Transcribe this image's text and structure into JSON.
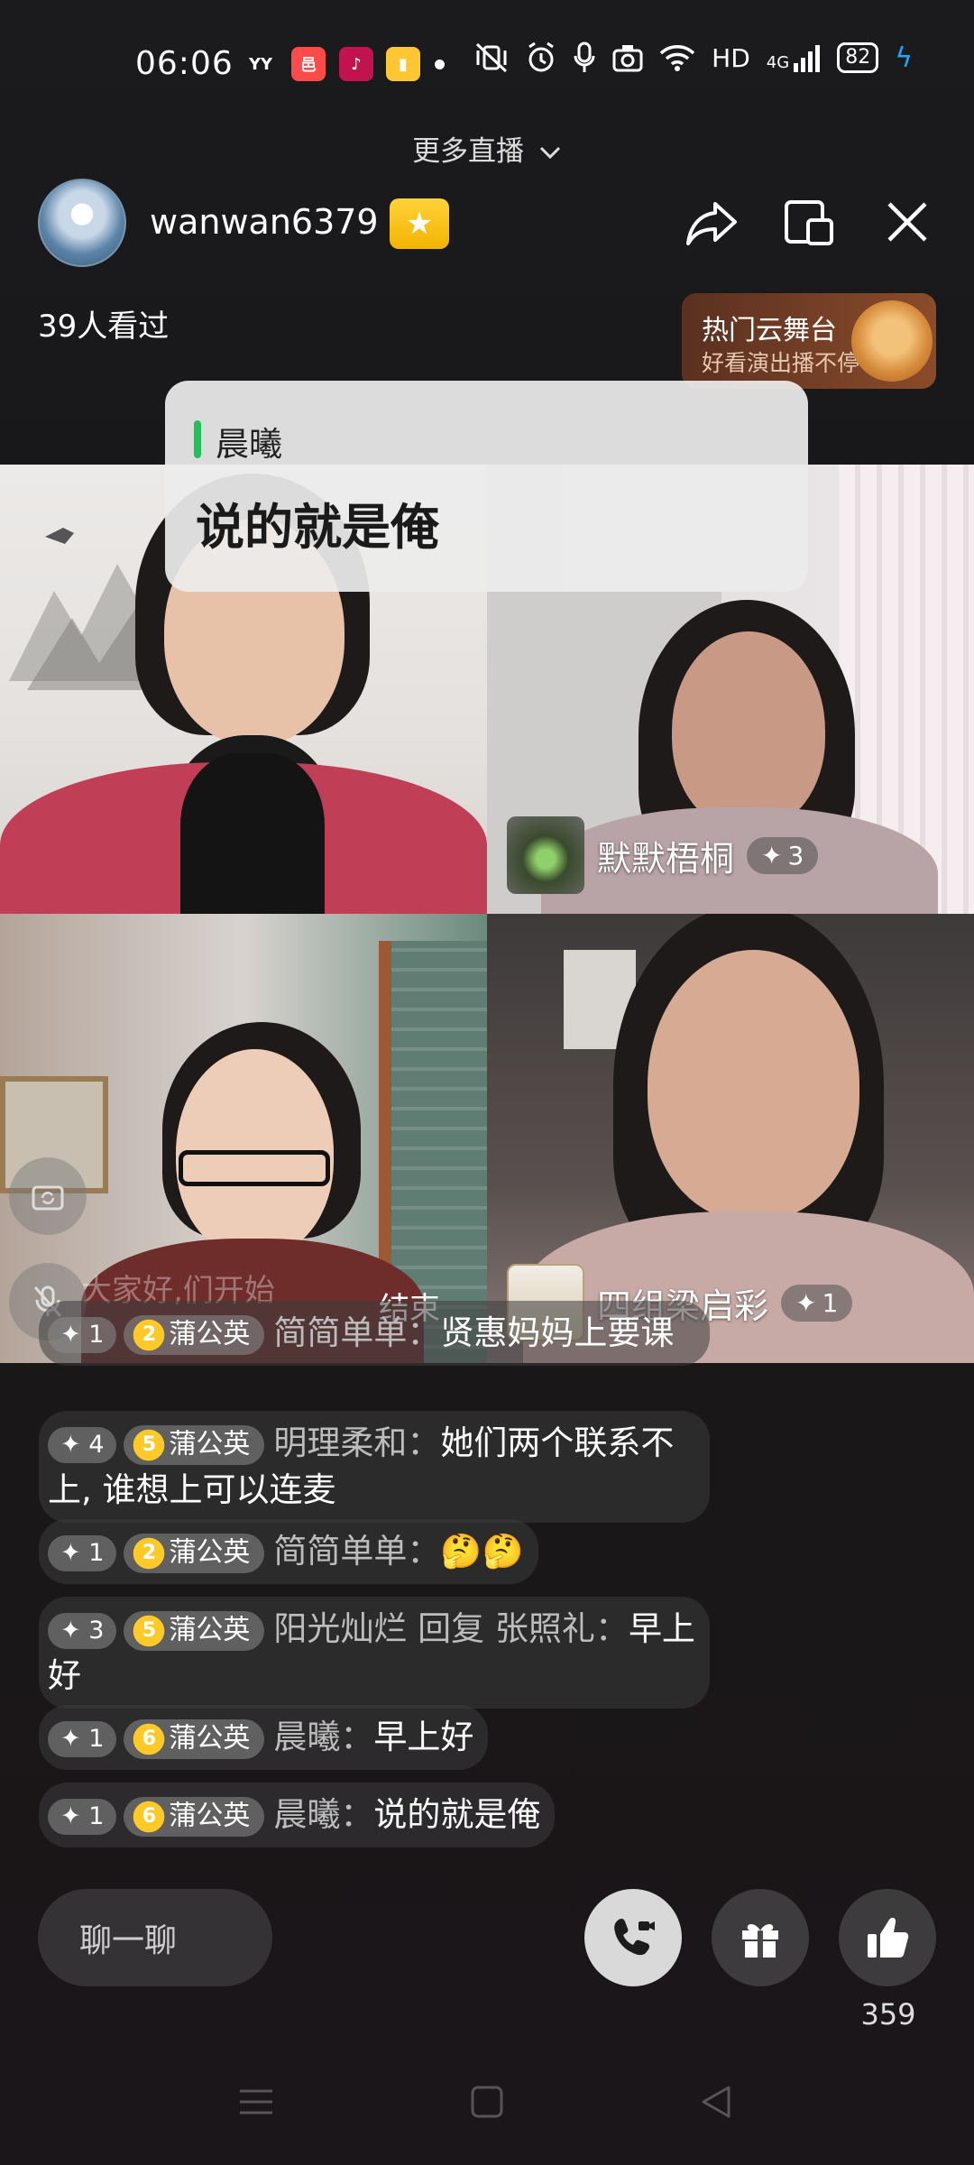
{
  "status_bar": {
    "time": "06:06",
    "app_badges": [
      {
        "name": "yy-app-icon",
        "text": "YY",
        "bg": "#ffd800",
        "fg": "#222"
      },
      {
        "name": "red-app-icon",
        "text": "邑",
        "bg": "#ff4a4a",
        "fg": "#fff"
      },
      {
        "name": "douyin-app-icon",
        "text": "♪",
        "bg": "#e0195b",
        "fg": "#fff"
      },
      {
        "name": "book-app-icon",
        "text": "▮",
        "bg": "#ffc634",
        "fg": "#fff"
      }
    ],
    "network": "HD",
    "signal_label": "4G",
    "battery": "82"
  },
  "header": {
    "more_live": "更多直播",
    "username": "wanwan6379",
    "viewers": "39人看过"
  },
  "promo": {
    "title": "热门云舞台",
    "subtitle": "好看演出播不停"
  },
  "pinned_comment": {
    "name": "晨曦",
    "text": "说的就是俺"
  },
  "tiles": {
    "tile2_user": "默默梧桐",
    "tile2_count": "3",
    "tile4_user": "四组梁启彩",
    "tile4_count": "1",
    "tile3_label_end": "结束",
    "tile3_blur_text": "大家好,们开始"
  },
  "chat": [
    {
      "level": "1",
      "fan_level": "2",
      "fan": "蒲公英",
      "who": "简简单单",
      "msg": "贤惠妈妈上要课"
    },
    {
      "level": "4",
      "fan_level": "5",
      "fan": "蒲公英",
      "who": "明理柔和",
      "msg": "她们两个联系不上, 谁想上可以连麦"
    },
    {
      "level": "1",
      "fan_level": "2",
      "fan": "蒲公英",
      "who": "简简单单",
      "msg": "🤔🤔"
    },
    {
      "level": "3",
      "fan_level": "5",
      "fan": "蒲公英",
      "who": "阳光灿烂 回复 张照礼",
      "msg": "早上好"
    },
    {
      "level": "1",
      "fan_level": "6",
      "fan": "蒲公英",
      "who": "晨曦",
      "msg": "早上好"
    },
    {
      "level": "1",
      "fan_level": "6",
      "fan": "蒲公英",
      "who": "晨曦",
      "msg": "说的就是俺"
    }
  ],
  "bottom": {
    "chat_placeholder": "聊一聊",
    "like_count": "359"
  }
}
